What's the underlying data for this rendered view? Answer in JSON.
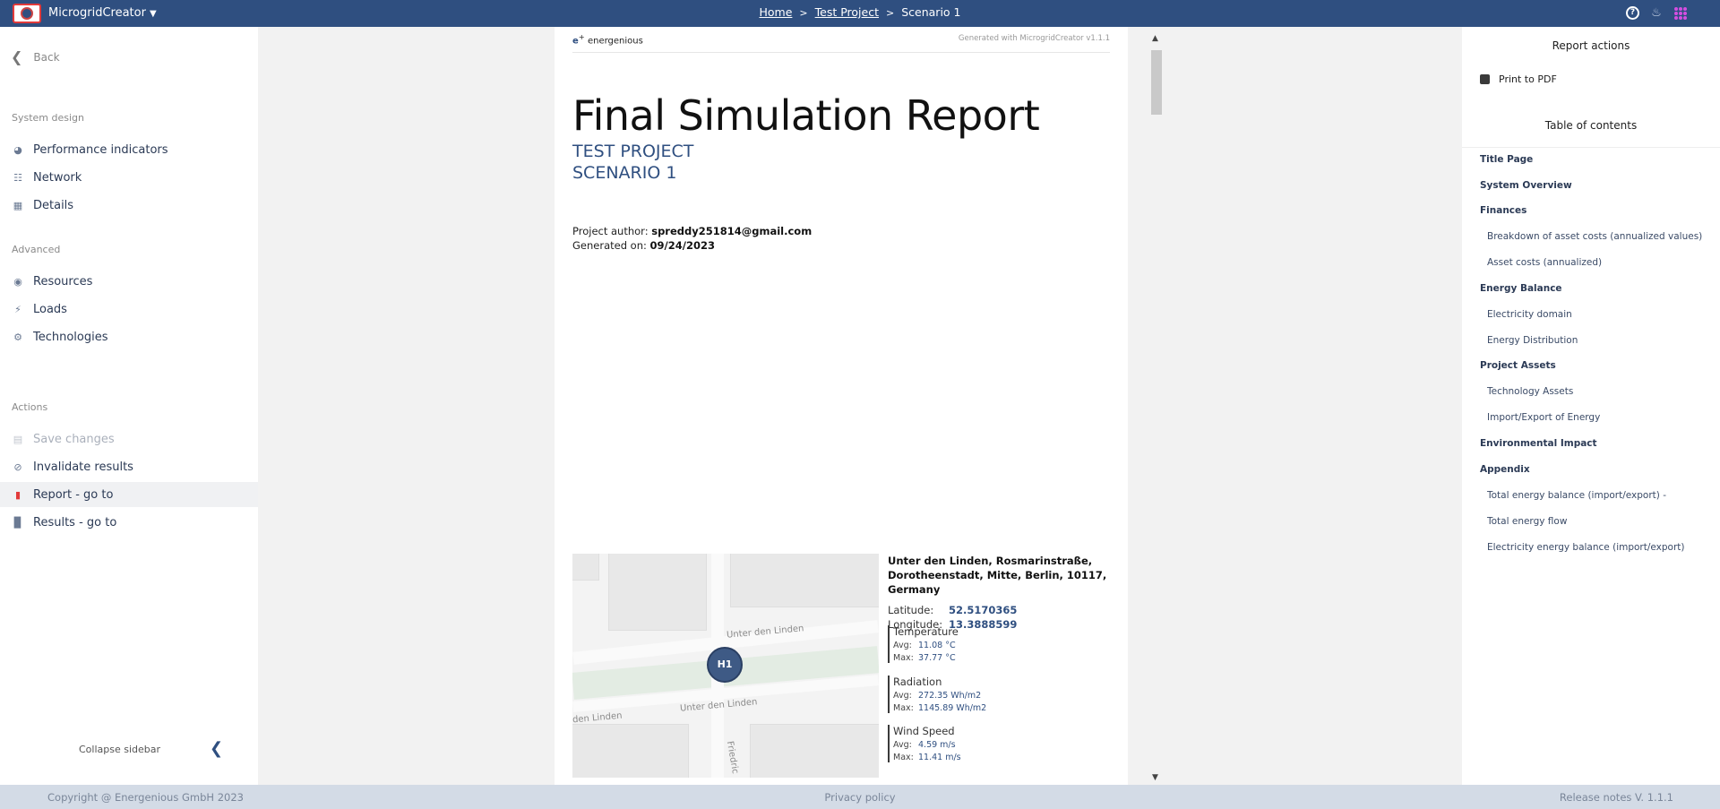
{
  "topbar": {
    "app_name": "MicrogridCreator",
    "crumbs": [
      "Home",
      "Test Project",
      "Scenario 1"
    ],
    "separator": ">",
    "icons": [
      "help-icon",
      "bell-icon",
      "apps-icon"
    ]
  },
  "sidebar": {
    "back": "Back",
    "sections": {
      "system_design": "System design",
      "advanced": "Advanced",
      "actions": "Actions"
    },
    "items": [
      {
        "label": "Performance indicators",
        "icon": "pie-chart-icon"
      },
      {
        "label": "Network",
        "icon": "network-icon"
      },
      {
        "label": "Details",
        "icon": "table-icon"
      },
      {
        "label": "Resources",
        "icon": "globe-icon"
      },
      {
        "label": "Loads",
        "icon": "bolt-icon"
      },
      {
        "label": "Technologies",
        "icon": "gears-icon"
      },
      {
        "label": "Save changes",
        "icon": "save-icon"
      },
      {
        "label": "Invalidate results",
        "icon": "ban-icon"
      },
      {
        "label": "Report - go to",
        "icon": "pdf-icon"
      },
      {
        "label": "Results - go to",
        "icon": "bar-chart-icon"
      }
    ],
    "collapse": "Collapse sidebar"
  },
  "report": {
    "logo": "energenious",
    "generated_with": "Generated with MicrogridCreator v1.1.1",
    "title": "Final Simulation Report",
    "project": "TEST PROJECT",
    "scenario": "SCENARIO 1",
    "author_label": "Project author:",
    "author": "spreddy251814@gmail.com",
    "generated_label": "Generated on:",
    "generated_on": "09/24/2023",
    "map": {
      "street_1": "Unter den Linden",
      "street_2": "Unter den Linden",
      "street_3": "den Linden",
      "street_4": "Friedric",
      "marker": "H1"
    },
    "address": "Unter den Linden, Rosmarinstraße, Dorotheenstadt, Mitte, Berlin, 10117, Germany",
    "latitude_label": "Latitude:",
    "latitude": "52.5170365",
    "longitude_label": "Longitude:",
    "longitude": "13.3888599",
    "weather": [
      {
        "name": "Temperature",
        "avg": "11.08 °C",
        "max": "37.77 °C"
      },
      {
        "name": "Radiation",
        "avg": "272.35 Wh/m2",
        "max": "1145.89 Wh/m2"
      },
      {
        "name": "Wind Speed",
        "avg": "4.59 m/s",
        "max": "11.41 m/s"
      }
    ],
    "avg_label": "Avg:",
    "max_label": "Max:"
  },
  "right_panel": {
    "title": "Report actions",
    "print": "Print to PDF",
    "toc_title": "Table of contents",
    "toc": [
      {
        "label": "Title Page",
        "level": 1
      },
      {
        "label": "System Overview",
        "level": 1
      },
      {
        "label": "Finances",
        "level": 1
      },
      {
        "label": "Breakdown of asset costs (annualized values)",
        "level": 2
      },
      {
        "label": "Asset costs (annualized)",
        "level": 2
      },
      {
        "label": "Energy Balance",
        "level": 1
      },
      {
        "label": "Electricity domain",
        "level": 2
      },
      {
        "label": "Energy Distribution",
        "level": 2
      },
      {
        "label": "Project Assets",
        "level": 1
      },
      {
        "label": "Technology Assets",
        "level": 2
      },
      {
        "label": "Import/Export of Energy",
        "level": 2
      },
      {
        "label": "Environmental Impact",
        "level": 1
      },
      {
        "label": "Appendix",
        "level": 1
      },
      {
        "label": "Total energy balance (import/export) -",
        "level": 2
      },
      {
        "label": "Total energy flow",
        "level": 2
      },
      {
        "label": "Electricity energy balance (import/export)",
        "level": 2
      }
    ]
  },
  "footer": {
    "copyright": "Copyright @ Energenious GmbH 2023",
    "privacy": "Privacy policy",
    "release": "Release notes V. 1.1.1"
  }
}
